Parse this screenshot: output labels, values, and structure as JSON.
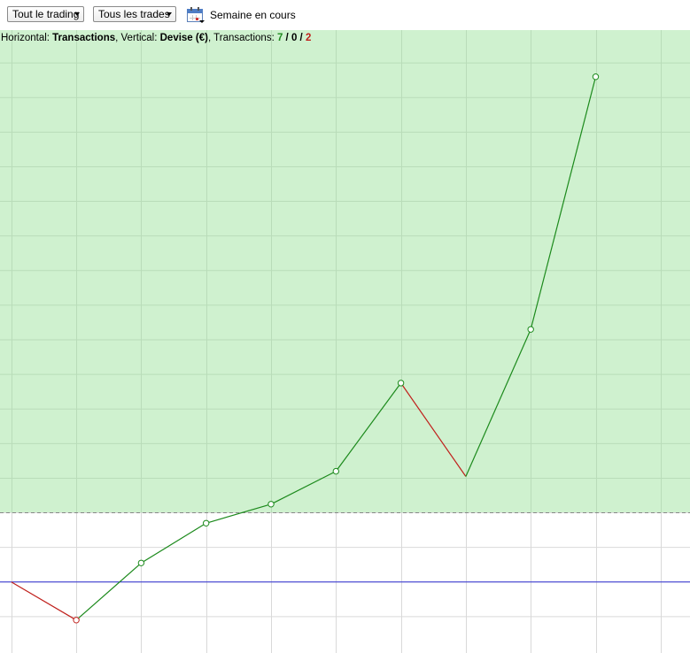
{
  "toolbar": {
    "account_filter": "Tout le trading",
    "trade_filter": "Tous les trades",
    "period_label": "Semaine en cours",
    "period_icon": "calendar-icon"
  },
  "summary": {
    "horizontal_label": "Horizontal: ",
    "horizontal_value": "Transactions",
    "sep1": ", ",
    "vertical_label": "Vertical: ",
    "vertical_value": "Devise (€)",
    "sep2": ", ",
    "transactions_label": "Transactions: ",
    "wins": "7",
    "slash1": " / ",
    "even": "0",
    "slash2": " / ",
    "losses": "2"
  },
  "colors": {
    "profit_zone": "#cff1cf",
    "grid": "#b9dcb9",
    "grid_white": "#d9d9d9",
    "zero_line": "#2a2ad0",
    "dashed_line": "#888888",
    "gain": "#1c8a1c",
    "loss": "#c0201c"
  },
  "chart_data": {
    "type": "line",
    "x": [
      0,
      1,
      2,
      3,
      4,
      5,
      6,
      7,
      8,
      9
    ],
    "y": [
      0,
      -1.1,
      0.55,
      1.7,
      2.25,
      3.2,
      5.75,
      3.05,
      7.3,
      14.6
    ],
    "outcomes": [
      "start",
      "loss",
      "win",
      "win",
      "win",
      "win",
      "win",
      "loss",
      "win",
      "win"
    ],
    "y_reference": 2.0,
    "xlim": [
      -1,
      12
    ],
    "ylim": [
      -2,
      16
    ],
    "grid": true
  }
}
